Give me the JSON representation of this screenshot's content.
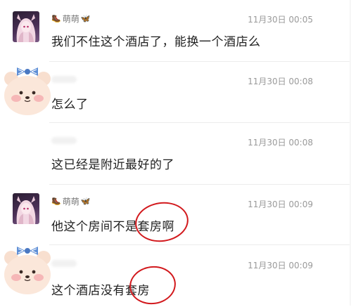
{
  "messages": [
    {
      "sender": {
        "name_prefix": "🥾",
        "name": "萌萌",
        "name_suffix": "🦋"
      },
      "time": "11月30日 00:05",
      "text": "我们不住这个酒店了，能换一个酒店么"
    },
    {
      "time": "11月30日 00:08",
      "text": "怎么了"
    },
    {
      "time": "11月30日 00:08",
      "text": "这已经是附近最好的了"
    },
    {
      "sender": {
        "name_prefix": "🥾",
        "name": "萌萌",
        "name_suffix": "🦋"
      },
      "time": "11月30日 00:09",
      "text": "他这个房间不是套房啊"
    },
    {
      "time": "11月30日 00:09",
      "text": "这个酒店没有套房"
    }
  ],
  "annotation_color": "#d2191d"
}
